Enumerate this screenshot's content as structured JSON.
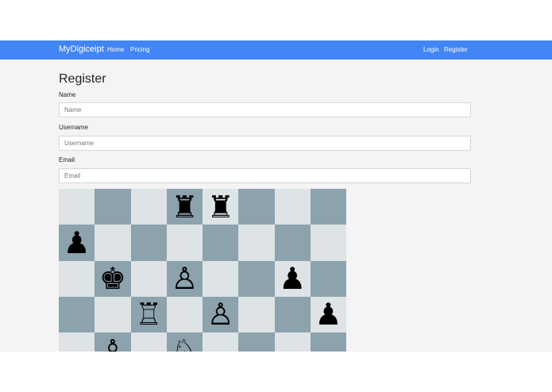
{
  "navbar": {
    "brand": "MyDigiceipt",
    "left_links": [
      "Home",
      "Pricing"
    ],
    "right_links": [
      "Login",
      "Register"
    ]
  },
  "form": {
    "title": "Register",
    "fields": [
      {
        "label": "Name",
        "placeholder": "Name",
        "value": ""
      },
      {
        "label": "Username",
        "placeholder": "Username",
        "value": ""
      },
      {
        "label": "Email",
        "placeholder": "Email",
        "value": ""
      }
    ]
  },
  "board": {
    "visible_rows": [
      [
        null,
        null,
        null,
        "black-rook",
        "black-rook",
        null,
        null,
        null
      ],
      [
        "black-pawn",
        null,
        null,
        null,
        null,
        null,
        null,
        null
      ],
      [
        null,
        "black-king",
        null,
        "white-pawn",
        null,
        null,
        "black-pawn",
        null
      ],
      [
        null,
        null,
        "white-rook",
        null,
        "white-pawn",
        null,
        null,
        "black-pawn"
      ],
      [
        null,
        "white-pawn",
        null,
        "white-knight",
        null,
        null,
        null,
        null
      ]
    ],
    "glyphs": {
      "black-rook": "♜",
      "black-pawn": "♟",
      "black-king": "♚",
      "white-rook": "♖",
      "white-pawn": "♙",
      "white-knight": "♘"
    },
    "colors": {
      "light": "#dee3e6",
      "dark": "#8ca2ad"
    }
  },
  "colors": {
    "navbar": "#4285f4",
    "page_bg": "#f4f4f4"
  }
}
